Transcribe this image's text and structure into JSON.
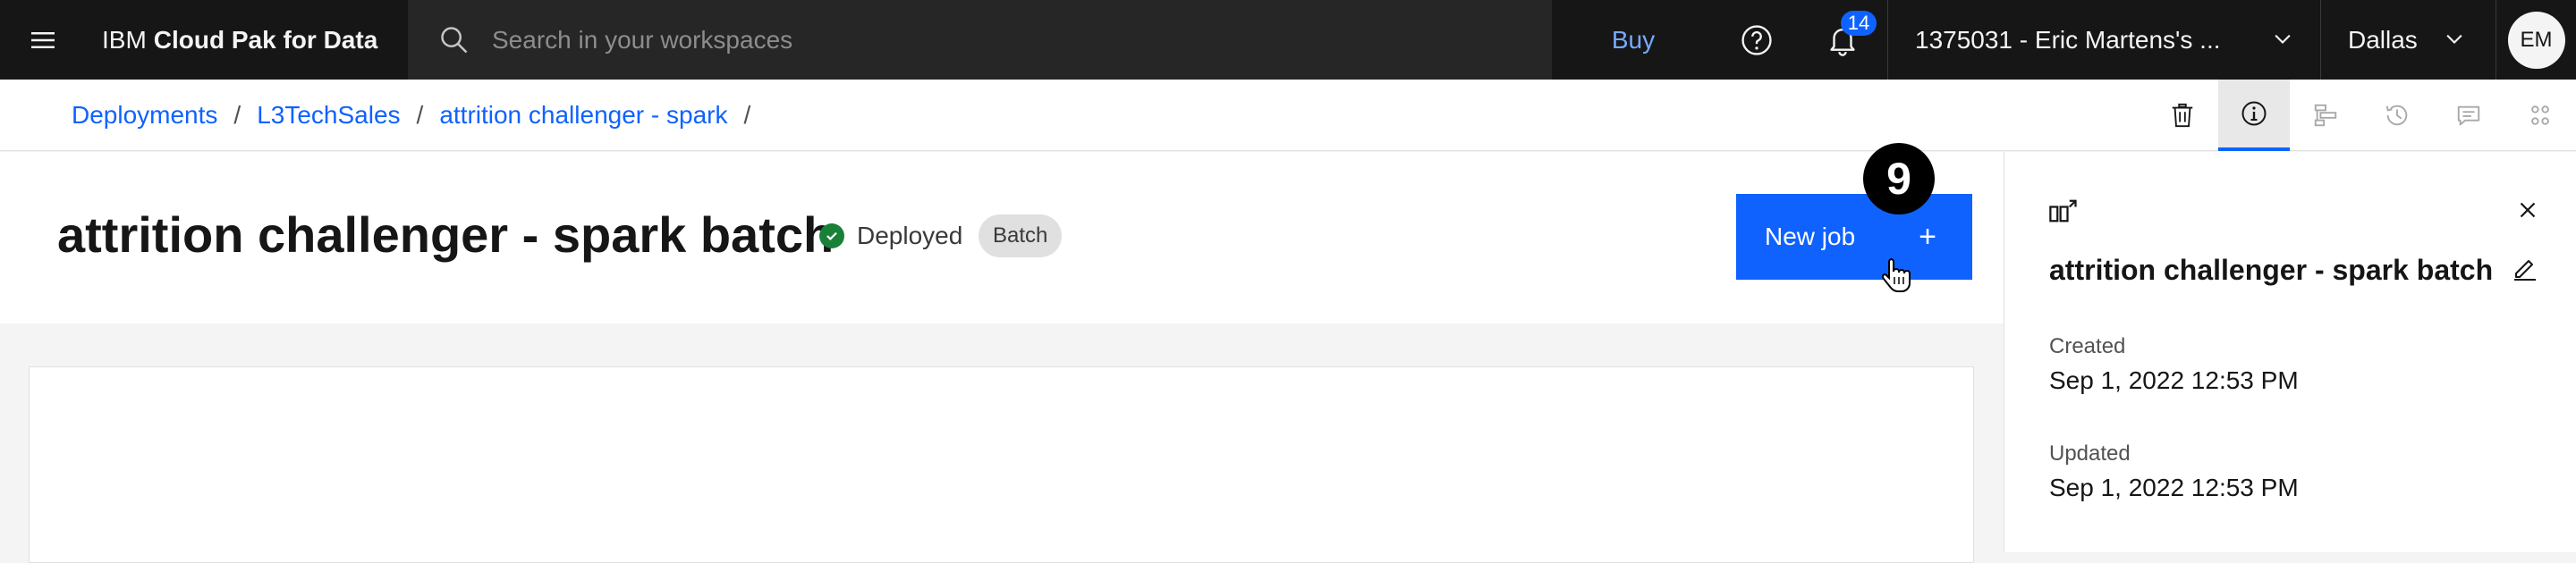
{
  "header": {
    "product_prefix": "IBM",
    "product_name": "Cloud Pak for Data",
    "search_placeholder": "Search in your workspaces",
    "buy_label": "Buy",
    "notification_count": "14",
    "account": "1375031 - Eric Martens's ...",
    "region": "Dallas",
    "avatar_initials": "EM",
    "icons": [
      "menu-icon",
      "search-icon",
      "help-icon",
      "notification-icon",
      "chevron-down-icon"
    ]
  },
  "breadcrumb": {
    "items": [
      "Deployments",
      "L3TechSales",
      "attrition challenger - spark"
    ],
    "separator": "/"
  },
  "toolbar": {
    "icons": [
      "delete-icon",
      "info-icon",
      "hierarchy-icon",
      "history-icon",
      "comment-icon",
      "settings-adjust-icon"
    ],
    "active": "info-icon"
  },
  "page": {
    "title": "attrition challenger - spark batch",
    "status": "Deployed",
    "tag": "Batch",
    "new_job_label": "New job",
    "new_job_icon": "+",
    "step_number": "9"
  },
  "side_panel": {
    "title": "attrition challenger - spark batch",
    "created_label": "Created",
    "created_value": "Sep 1, 2022 12:53 PM",
    "updated_label": "Updated",
    "updated_value": "Sep 1, 2022 12:53 PM"
  },
  "colors": {
    "header_bg": "#161616",
    "primary": "#0f62fe",
    "link": "#0f62fe",
    "buy_link": "#78a9ff",
    "status_green": "#198038"
  }
}
